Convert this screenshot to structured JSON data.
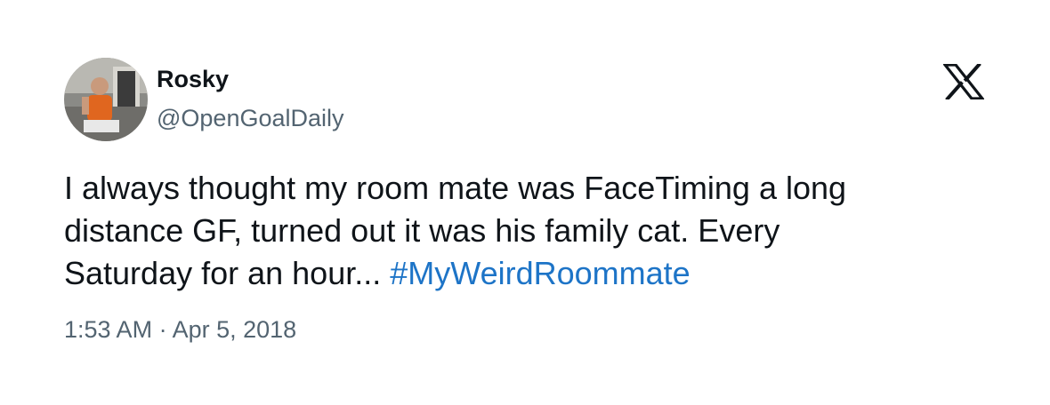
{
  "author": {
    "display_name": "Rosky",
    "handle": "@OpenGoalDaily",
    "avatar_icon": "profile-photo"
  },
  "platform_icon": "x-logo-icon",
  "tweet": {
    "lines": [
      "I always thought my room mate was FaceTiming a long",
      "distance GF, turned out it was his family cat. Every",
      "Saturday for an hour... "
    ],
    "hashtag": "#MyWeirdRoommate",
    "hashtag_color": "#1d74c7",
    "timestamp": "1:53 AM · Apr 5, 2018"
  }
}
